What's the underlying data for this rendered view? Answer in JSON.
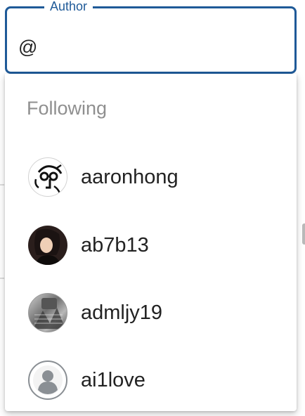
{
  "author_field": {
    "label": "Author",
    "value": "@"
  },
  "dropdown": {
    "group_header": "Following",
    "options": [
      {
        "username": "aaronhong",
        "avatar_icon": "sketch-face-avatar-icon"
      },
      {
        "username": "ab7b13",
        "avatar_icon": "photo-portrait-avatar-icon"
      },
      {
        "username": "admljy19",
        "avatar_icon": "photo-grayscale-avatar-icon"
      },
      {
        "username": "ai1love",
        "avatar_icon": "default-user-avatar-icon"
      }
    ]
  },
  "colors": {
    "accent": "#1f5a98",
    "group_header": "#8f8f8f",
    "text": "#222222"
  }
}
